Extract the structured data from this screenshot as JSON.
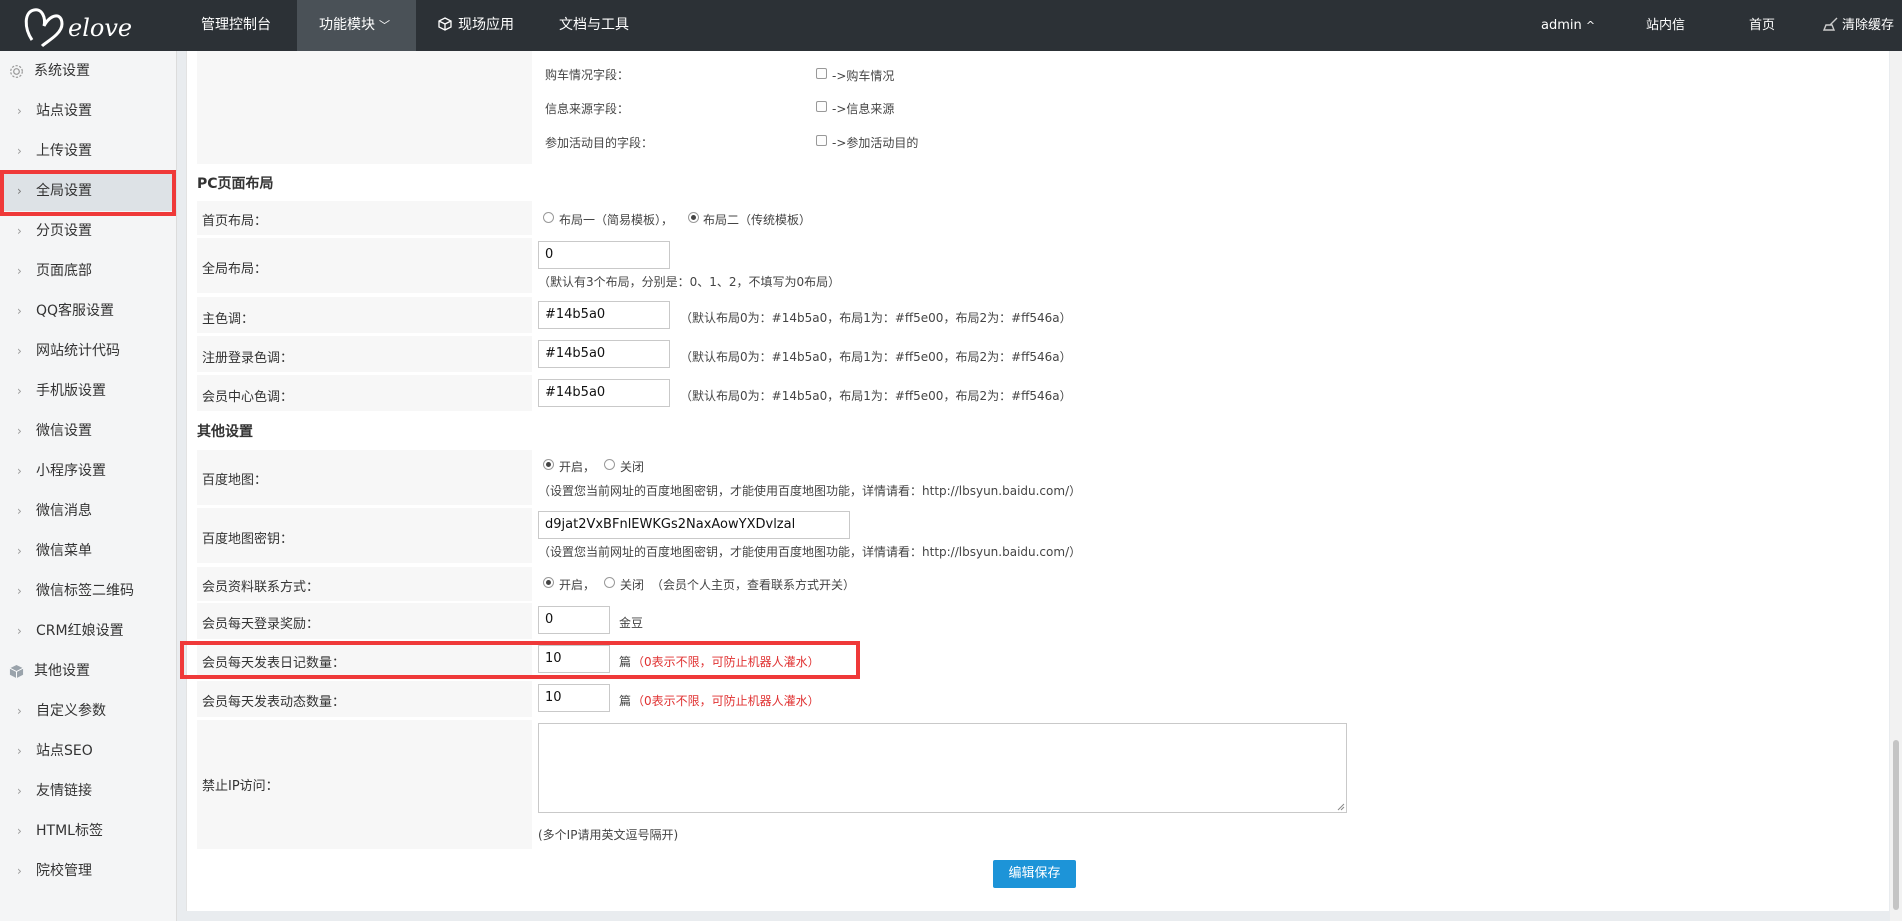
{
  "topnav": {
    "items": [
      "管理控制台",
      "功能模块",
      "现场应用",
      "文档与工具"
    ],
    "right": {
      "user": "admin",
      "messages": "站内信",
      "home": "首页",
      "clear_cache": "清除缓存"
    }
  },
  "sidebar": {
    "group1": "系统设置",
    "items1": [
      "站点设置",
      "上传设置",
      "全局设置",
      "分页设置",
      "页面底部",
      "QQ客服设置",
      "网站统计代码",
      "手机版设置",
      "微信设置",
      "小程序设置",
      "微信消息",
      "微信菜单",
      "微信标签二维码",
      "CRM红娘设置"
    ],
    "group2": "其他设置",
    "items2": [
      "自定义参数",
      "站点SEO",
      "友情链接",
      "HTML标签",
      "院校管理"
    ]
  },
  "fields_top": {
    "car_label": "购车情况字段：",
    "car_cb": "->购车情况",
    "source_label": "信息来源字段：",
    "source_cb": "->信息来源",
    "purpose_label": "参加活动目的字段：",
    "purpose_cb": "->参加活动目的"
  },
  "pc_layout": {
    "title": "PC页面布局",
    "home_label": "首页布局：",
    "home_opt1": "布局一（简易模板），",
    "home_opt2": "布局二（传统模板）",
    "global_label": "全局布局：",
    "global_value": "0",
    "global_hint": "（默认有3个布局，分别是：0、1、2，不填写为0布局）",
    "main_color_label": "主色调：",
    "main_color_value": "#14b5a0",
    "reg_color_label": "注册登录色调：",
    "reg_color_value": "#14b5a0",
    "member_color_label": "会员中心色调：",
    "member_color_value": "#14b5a0",
    "color_hint": "（默认布局0为：#14b5a0，布局1为：#ff5e00，布局2为：#ff546a）"
  },
  "other": {
    "title": "其他设置",
    "baidu_map_label": "百度地图：",
    "on": "开启，",
    "off": "关闭",
    "baidu_map_hint": "（设置您当前网址的百度地图密钥，才能使用百度地图功能，详情请看：http://lbsyun.baidu.com/）",
    "baidu_key_label": "百度地图密钥：",
    "baidu_key_value": "d9jat2VxBFnlEWKGs2NaxAowYXDvlzal",
    "contact_label": "会员资料联系方式：",
    "contact_hint": "（会员个人主页，查看联系方式开关）",
    "login_reward_label": "会员每天登录奖励：",
    "login_reward_value": "0",
    "login_reward_unit": "金豆",
    "diary_label": "会员每天发表日记数量：",
    "diary_value": "10",
    "diary_unit": "篇",
    "diary_hint": "（0表示不限，可防止机器人灌水）",
    "dynamic_label": "会员每天发表动态数量：",
    "dynamic_value": "10",
    "dynamic_unit": "篇",
    "dynamic_hint": "（0表示不限，可防止机器人灌水）",
    "ban_ip_label": "禁止IP访问：",
    "ban_ip_hint": "(多个IP请用英文逗号隔开)",
    "save": "编辑保存"
  }
}
